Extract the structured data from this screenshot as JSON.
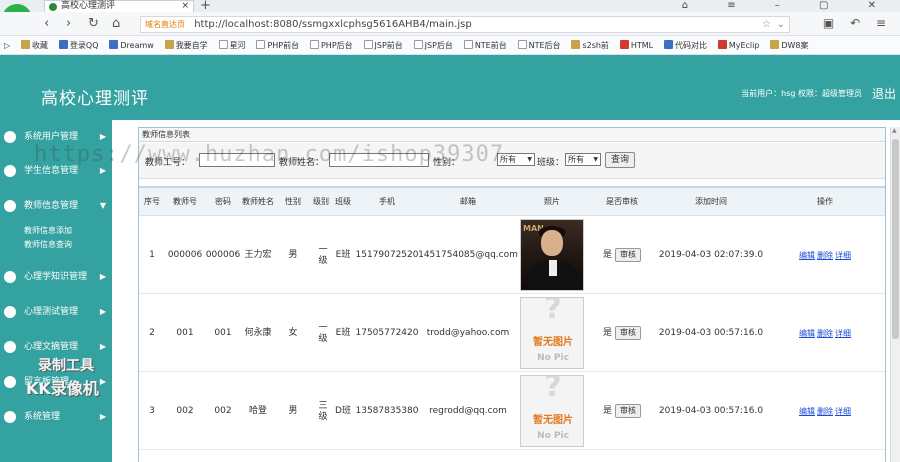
{
  "browser": {
    "tab_title": "高校心理测评",
    "url_badge": "域名直达页",
    "url": "http://localhost:8080/ssmgxxlcphsg5616AHB4/main.jsp",
    "bookmarks": [
      "收藏",
      "登录QQ",
      "Dreamw",
      "我要自学",
      "星河",
      "PHP前台",
      "PHP后台",
      "JSP前台",
      "JSP后台",
      "NTE前台",
      "NTE后台",
      "s2sh前",
      "HTML",
      "代码对比",
      "MyEclip",
      "DW8案"
    ]
  },
  "header": {
    "title": "高校心理测评",
    "user_info": "当前用户：hsg  权限：超级管理员",
    "logout": "退出"
  },
  "sidebar": {
    "items": [
      {
        "label": "系统用户管理",
        "icon": "user-group-icon"
      },
      {
        "label": "学生信息管理",
        "icon": "student-icon"
      },
      {
        "label": "教师信息管理",
        "icon": "teacher-icon"
      },
      {
        "label": "心理学知识管理",
        "icon": "knowledge-icon"
      },
      {
        "label": "心理测试管理",
        "icon": "test-icon"
      },
      {
        "label": "心理文摘管理",
        "icon": "article-icon"
      },
      {
        "label": "留言板管理",
        "icon": "message-icon"
      },
      {
        "label": "系统管理",
        "icon": "settings-icon"
      }
    ],
    "sub_items": [
      "教师信息添加",
      "教师信息查询"
    ]
  },
  "panel": {
    "title": "教师信息列表",
    "search": {
      "teacher_id_label": "教师工号：",
      "teacher_id_value": "",
      "name_label": "教师姓名：",
      "name_value": "",
      "gender_label": "性别：",
      "gender_value": "所有",
      "class_label": "班级：",
      "class_value": "所有",
      "query_button": "查询"
    },
    "columns": [
      "序号",
      "教师号",
      "密码",
      "教师姓名",
      "性别",
      "级别",
      "班级",
      "手机",
      "邮箱",
      "照片",
      "是否审核",
      "添加时间",
      "操作"
    ],
    "rows": [
      {
        "no": "1",
        "teacher_no": "000006",
        "password": "000006",
        "name": "王力宏",
        "gender": "男",
        "level": "一级",
        "class": "E班",
        "phone": "15179072520",
        "email": "1451754085@qq.com",
        "photo": "real",
        "audited": "是",
        "audit_btn": "审核",
        "time": "2019-04-03 02:07:39.0",
        "ops": [
          "编辑",
          "删除",
          "详细"
        ]
      },
      {
        "no": "2",
        "teacher_no": "001",
        "password": "001",
        "name": "何永康",
        "gender": "女",
        "level": "一级",
        "class": "E班",
        "phone": "17505772420",
        "email": "trodd@yahoo.com",
        "photo": "none",
        "audited": "是",
        "audit_btn": "审核",
        "time": "2019-04-03 00:57:16.0",
        "ops": [
          "编辑",
          "删除",
          "详细"
        ]
      },
      {
        "no": "3",
        "teacher_no": "002",
        "password": "002",
        "name": "哈登",
        "gender": "男",
        "level": "三级",
        "class": "D班",
        "phone": "13587835380",
        "email": "regrodd@qq.com",
        "photo": "none",
        "audited": "是",
        "audit_btn": "审核",
        "time": "2019-04-03 00:57:16.0",
        "ops": [
          "编辑",
          "删除",
          "详细"
        ]
      }
    ],
    "photo_placeholder": {
      "mark": "?",
      "line1": "暂无图片",
      "line2": "No Pic"
    },
    "photo_real_caption": "MAN"
  },
  "overlays": {
    "watermark": "https://www.huzhan.com/ishop39307",
    "recorder_line1": "录制工具",
    "recorder_line2": "KK录像机"
  },
  "colors": {
    "accent": "#34a2a0",
    "link": "#1a4bd6"
  }
}
